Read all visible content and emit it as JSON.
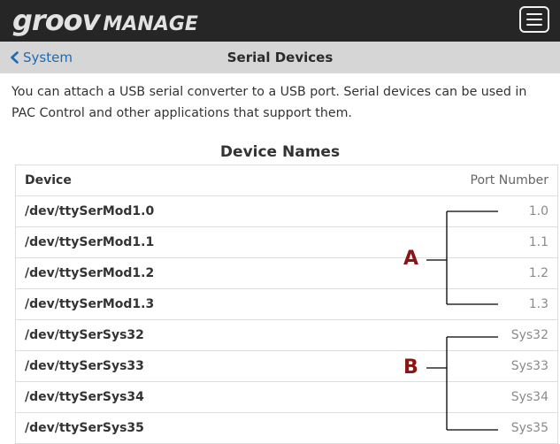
{
  "header": {
    "logo_part1": "groov",
    "logo_part2": "MANAGE",
    "menu_icon": "hamburger-menu-icon"
  },
  "nav": {
    "back_label": "System",
    "back_icon": "chevron-left-icon",
    "title": "Serial Devices"
  },
  "intro": "You can attach a USB serial converter to a USB port. Serial devices can be used in PAC Control and other applications that support them.",
  "section_title": "Device Names",
  "table": {
    "headers": {
      "device": "Device",
      "port": "Port Number"
    },
    "rows": [
      {
        "device": "/dev/ttySerMod1.0",
        "port": "1.0"
      },
      {
        "device": "/dev/ttySerMod1.1",
        "port": "1.1"
      },
      {
        "device": "/dev/ttySerMod1.2",
        "port": "1.2"
      },
      {
        "device": "/dev/ttySerMod1.3",
        "port": "1.3"
      },
      {
        "device": "/dev/ttySerSys32",
        "port": "Sys32"
      },
      {
        "device": "/dev/ttySerSys33",
        "port": "Sys33"
      },
      {
        "device": "/dev/ttySerSys34",
        "port": "Sys34"
      },
      {
        "device": "/dev/ttySerSys35",
        "port": "Sys35"
      }
    ]
  },
  "callouts": {
    "a_label": "A",
    "b_label": "B",
    "color": "#8b1414"
  },
  "colors": {
    "app_bar": "#262626",
    "nav_bar": "#d6d6d6",
    "link": "#1f6ab3"
  }
}
